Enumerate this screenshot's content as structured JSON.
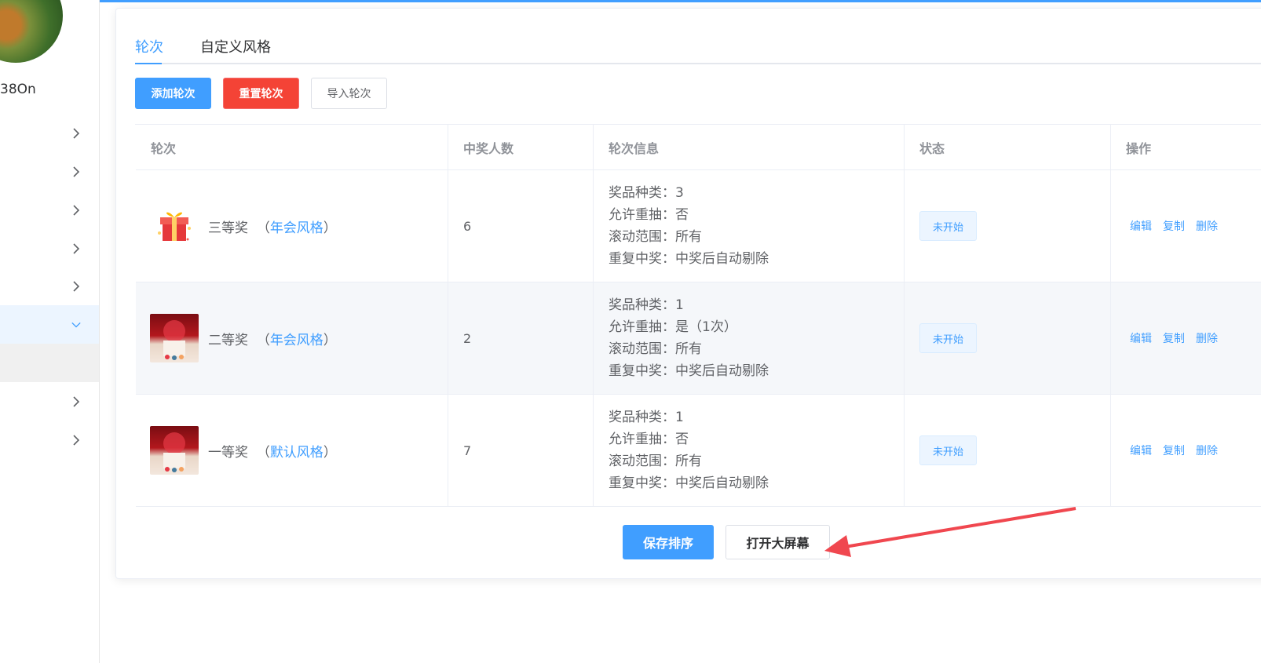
{
  "sidebar": {
    "username": "38On",
    "items": [
      {
        "glyph": "",
        "state": "collapsed"
      },
      {
        "glyph": "",
        "state": "collapsed"
      },
      {
        "glyph": "",
        "state": "collapsed"
      },
      {
        "glyph": "",
        "state": "collapsed"
      },
      {
        "glyph": "",
        "state": "collapsed"
      },
      {
        "glyph": "",
        "state": "expanded"
      },
      {
        "glyph": "",
        "state": "collapsed"
      },
      {
        "glyph": "",
        "state": "collapsed"
      }
    ]
  },
  "tabs": [
    "轮次",
    "自定义风格"
  ],
  "active_tab": "轮次",
  "toolbar": {
    "add_label": "添加轮次",
    "reset_label": "重置轮次",
    "import_label": "导入轮次"
  },
  "table": {
    "headers": [
      "轮次",
      "中奖人数",
      "轮次信息",
      "状态",
      "操作"
    ],
    "rows": [
      {
        "name": "三等奖",
        "style_open": "（",
        "style": "年会风格",
        "style_close": "）",
        "winners": "6",
        "info": [
          "奖品种类：3",
          "允许重抽：否",
          "滚动范围：所有",
          "重复中奖：中奖后自动剔除"
        ],
        "status": "未开始",
        "image": "gift-box-icon"
      },
      {
        "name": "二等奖",
        "style_open": "（",
        "style": "年会风格",
        "style_close": "）",
        "winners": "2",
        "info": [
          "奖品种类：1",
          "允许重抽：是（1次）",
          "滚动范围：所有",
          "重复中奖：中奖后自动剔除"
        ],
        "status": "未开始",
        "image": "red-poster-image"
      },
      {
        "name": "一等奖",
        "style_open": "（",
        "style": "默认风格",
        "style_close": "）",
        "winners": "7",
        "info": [
          "奖品种类：1",
          "允许重抽：否",
          "滚动范围：所有",
          "重复中奖：中奖后自动剔除"
        ],
        "status": "未开始",
        "image": "red-poster-image"
      }
    ],
    "actions": {
      "edit": "编辑",
      "copy": "复制",
      "delete": "删除"
    }
  },
  "footer": {
    "save_label": "保存排序",
    "screen_label": "打开大屏幕"
  },
  "colors": {
    "primary": "#409eff",
    "danger": "#f44336",
    "annotation": "#f0474f"
  }
}
